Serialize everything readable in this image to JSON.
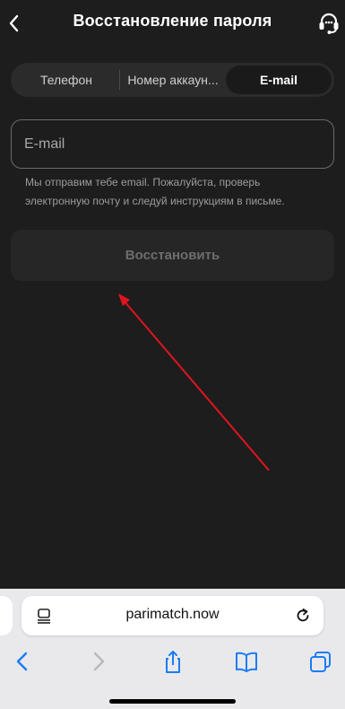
{
  "header": {
    "title": "Восстановление пароля",
    "back_icon": "chevron-left-icon",
    "support_icon": "headset-icon"
  },
  "tabs": [
    {
      "label": "Телефон",
      "active": false
    },
    {
      "label": "Номер аккаун...",
      "active": false
    },
    {
      "label": "E-mail",
      "active": true
    }
  ],
  "form": {
    "email_placeholder": "E-mail",
    "email_value": "",
    "hint": "Мы отправим тебе email. Пожалуйста, проверь электронную почту и следуй инструкциям в письме.",
    "submit_label": "Восстановить"
  },
  "browser": {
    "url": "parimatch.now",
    "reader_icon": "page-menu-icon",
    "reload_icon": "reload-icon",
    "toolbar_icons": [
      "back-icon",
      "forward-icon",
      "share-icon",
      "bookmarks-icon",
      "tabs-icon"
    ]
  },
  "colors": {
    "background": "#1d1d1d",
    "annotation_arrow": "#e0141e",
    "browser_accent": "#1a7cf5"
  }
}
